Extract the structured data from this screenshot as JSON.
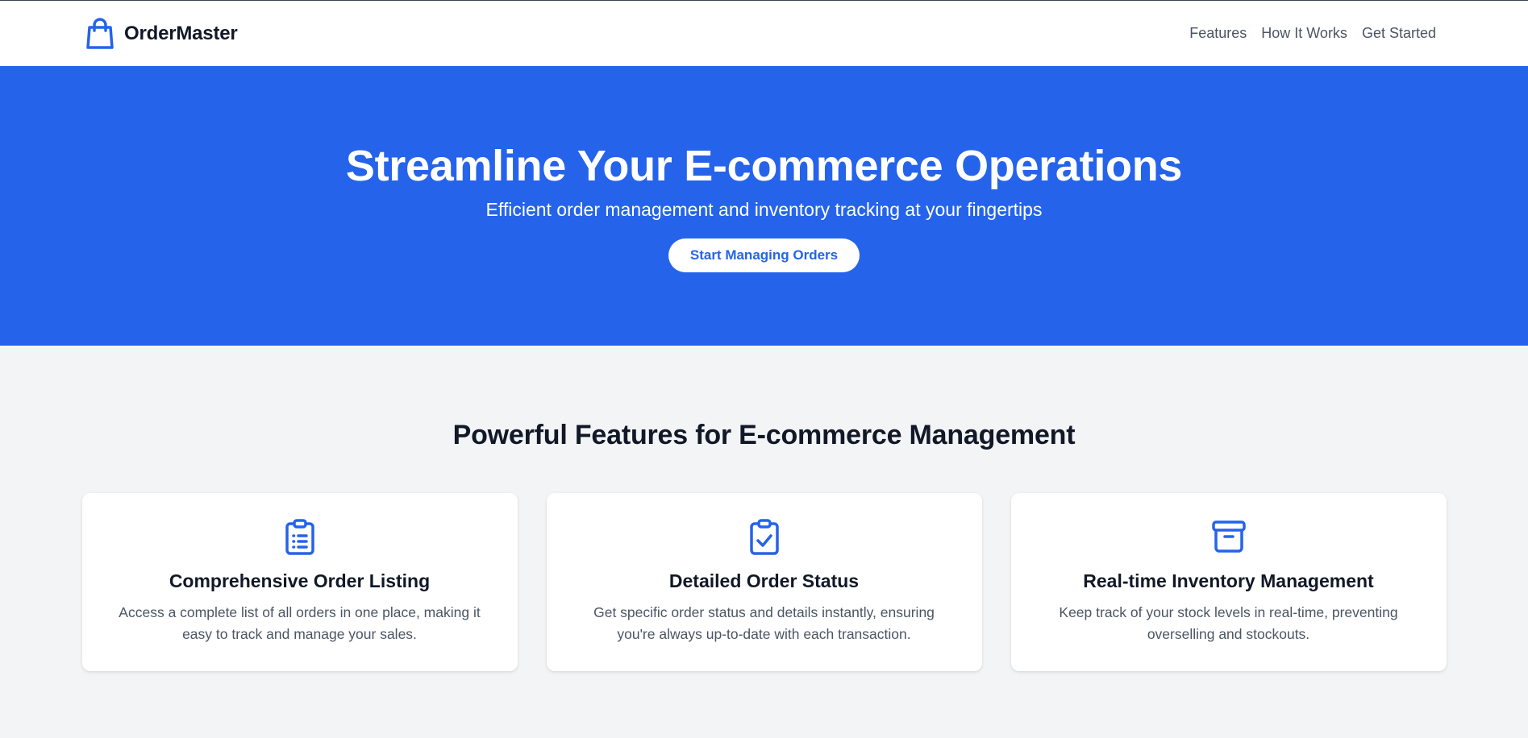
{
  "header": {
    "brand_icon": "shopping-bag-icon",
    "brand_name": "OrderMaster",
    "nav": [
      {
        "label": "Features"
      },
      {
        "label": "How It Works"
      },
      {
        "label": "Get Started"
      }
    ]
  },
  "hero": {
    "title": "Streamline Your E-commerce Operations",
    "subtitle": "Efficient order management and inventory tracking at your fingertips",
    "cta_label": "Start Managing Orders"
  },
  "features": {
    "title": "Powerful Features for E-commerce Management",
    "cards": [
      {
        "icon": "clipboard-list-icon",
        "title": "Comprehensive Order Listing",
        "description": "Access a complete list of all orders in one place, making it easy to track and manage your sales."
      },
      {
        "icon": "clipboard-check-icon",
        "title": "Detailed Order Status",
        "description": "Get specific order status and details instantly, ensuring you're always up-to-date with each transaction."
      },
      {
        "icon": "archive-box-icon",
        "title": "Real-time Inventory Management",
        "description": "Keep track of your stock levels in real-time, preventing overselling and stockouts."
      }
    ]
  },
  "colors": {
    "primary": "#2563eb",
    "background": "#f3f4f6",
    "text_dark": "#111827",
    "text_muted": "#4b5563"
  }
}
